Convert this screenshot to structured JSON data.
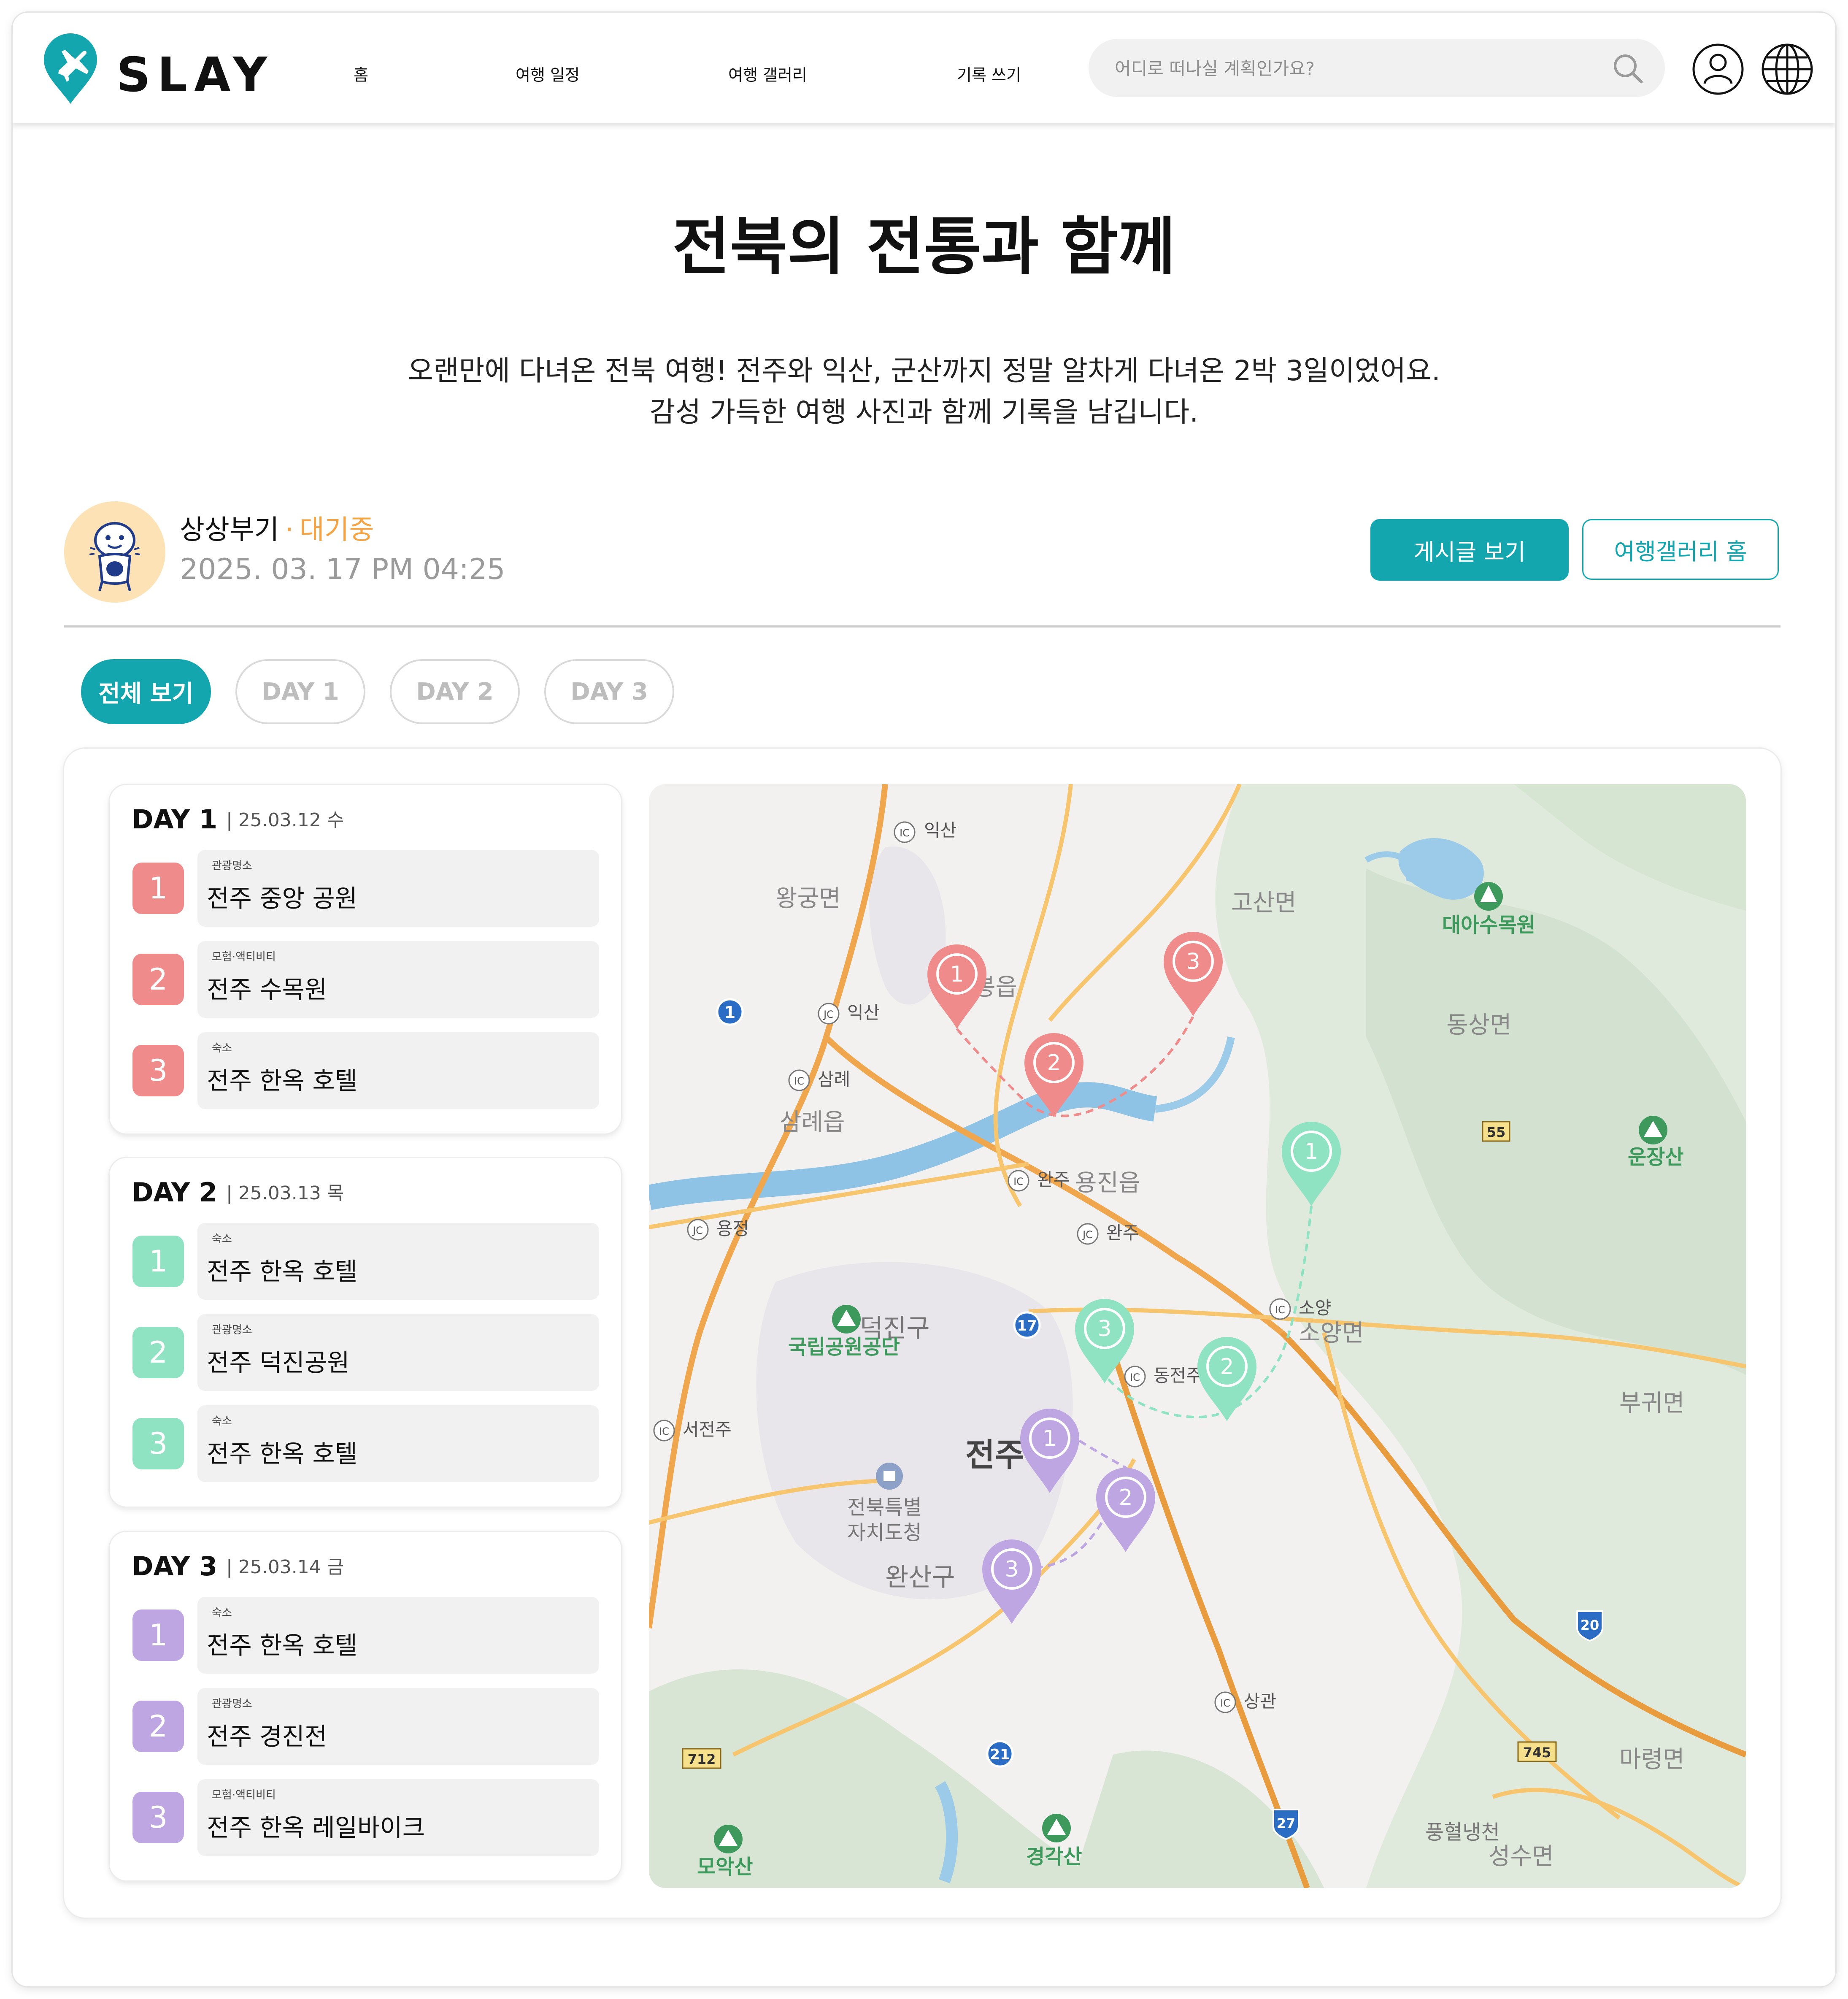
{
  "header": {
    "logo_text": "SLAY",
    "nav": [
      "홈",
      "여행 일정",
      "여행 갤러리",
      "기록 쓰기"
    ],
    "search_placeholder": "어디로 떠나실 계획인가요?"
  },
  "post": {
    "title": "전북의 전통과 함께",
    "description_lines": [
      "오랜만에 다녀온 전북 여행! 전주와 익산, 군산까지 정말 알차게 다녀온 2박 3일이었어요.",
      "감성 가득한 여행 사진과 함께 기록을 남깁니다."
    ]
  },
  "author": {
    "name": "상상부기",
    "status": "대기중",
    "datetime": "2025. 03. 17 PM 04:25",
    "avatar_icon": "mascot-avatar-icon"
  },
  "actions": {
    "view_post": "게시글 보기",
    "gallery_home": "여행갤러리 홈"
  },
  "tabs": [
    "전체 보기",
    "DAY 1",
    "DAY 2",
    "DAY 3"
  ],
  "active_tab": "전체 보기",
  "colors": {
    "accent": "#13a6ae",
    "status": "#f5a343",
    "day1": "#f08b8b",
    "day2": "#8fe3c3",
    "day3": "#bea6e3"
  },
  "days": [
    {
      "title": "DAY 1",
      "date": "| 25.03.12 수",
      "items": [
        {
          "num": "1",
          "category": "관광명소",
          "name": "전주 중앙 공원"
        },
        {
          "num": "2",
          "category": "모험·액티비티",
          "name": "전주 수목원"
        },
        {
          "num": "3",
          "category": "숙소",
          "name": "전주 한옥 호텔"
        }
      ]
    },
    {
      "title": "DAY 2",
      "date": "| 25.03.13 목",
      "items": [
        {
          "num": "1",
          "category": "숙소",
          "name": "전주 한옥 호텔"
        },
        {
          "num": "2",
          "category": "관광명소",
          "name": "전주 덕진공원"
        },
        {
          "num": "3",
          "category": "숙소",
          "name": "전주 한옥 호텔"
        }
      ]
    },
    {
      "title": "DAY 3",
      "date": "| 25.03.14 금",
      "items": [
        {
          "num": "1",
          "category": "숙소",
          "name": "전주 한옥 호텔"
        },
        {
          "num": "2",
          "category": "관광명소",
          "name": "전주 경진전"
        },
        {
          "num": "3",
          "category": "모험·액티비티",
          "name": "전주 한옥 레일바이크"
        }
      ]
    }
  ],
  "map": {
    "labels": {
      "iksan_ic": "익산",
      "wanggung": "왕궁면",
      "gosan": "고산면",
      "daea": "대아수목원",
      "dongsang": "동상면",
      "samrye_ic": "삼례",
      "samrye": "삼례읍",
      "iksan_jc": "익산",
      "wanju_ic": "완주",
      "yongjin": "용진읍",
      "yongjeong_jc": "용정",
      "wanju_jc": "완주",
      "unjangsan": "운장산",
      "soyang_ic": "소양",
      "soyang": "소양면",
      "deokjin": "덕진구",
      "national_park": "국립공원공단",
      "dongjeonju_ic": "동전주",
      "seojeonju_ic": "서전주",
      "jeonju": "전주",
      "doe": "전북특별",
      "doe2": "자치도청",
      "wansan": "완산구",
      "bugwi": "부귀면",
      "sanggwan_ic": "상관",
      "maryeong": "마령면",
      "moaksan": "모악산",
      "gyeonggaksan": "경각산",
      "pungheol": "풍혈냉천",
      "seongsu": "성수면",
      "eup": "봉읍"
    },
    "route_numbers": [
      "1",
      "17",
      "21",
      "27",
      "20",
      "55",
      "712",
      "745"
    ]
  }
}
